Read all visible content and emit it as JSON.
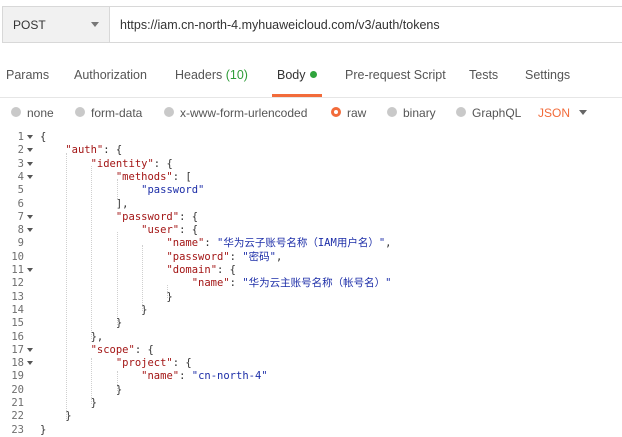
{
  "request": {
    "method": "POST",
    "url": "https://iam.cn-north-4.myhuaweicloud.com/v3/auth/tokens"
  },
  "tabs": [
    {
      "label": "Params"
    },
    {
      "label": "Authorization"
    },
    {
      "label": "Headers",
      "count": "(10)"
    },
    {
      "label": "Body"
    },
    {
      "label": "Pre-request Script"
    },
    {
      "label": "Tests"
    },
    {
      "label": "Settings"
    }
  ],
  "body_types": [
    {
      "label": "none",
      "selected": false
    },
    {
      "label": "form-data",
      "selected": false
    },
    {
      "label": "x-www-form-urlencoded",
      "selected": false
    },
    {
      "label": "raw",
      "selected": true
    },
    {
      "label": "binary",
      "selected": false
    },
    {
      "label": "GraphQL",
      "selected": false
    }
  ],
  "format": "JSON",
  "colors": {
    "accent": "#f26b3a",
    "active_dot": "#2fa43c",
    "key": "#a31515",
    "string": "#1d2ea8"
  },
  "code_lines": [
    {
      "n": "1",
      "text": "{"
    },
    {
      "n": "2",
      "text": "    \"auth\": {"
    },
    {
      "n": "3",
      "text": "        \"identity\": {"
    },
    {
      "n": "4",
      "text": "            \"methods\": ["
    },
    {
      "n": "5",
      "text": "                \"password\""
    },
    {
      "n": "6",
      "text": "            ],"
    },
    {
      "n": "7",
      "text": "            \"password\": {"
    },
    {
      "n": "8",
      "text": "                \"user\": {"
    },
    {
      "n": "9",
      "text": "                    \"name\": \"华为云子账号名称（IAM用户名）\","
    },
    {
      "n": "10",
      "text": "                    \"password\": \"密码\","
    },
    {
      "n": "11",
      "text": "                    \"domain\": {"
    },
    {
      "n": "12",
      "text": "                        \"name\": \"华为云主账号名称（帐号名）\""
    },
    {
      "n": "13",
      "text": "                    }"
    },
    {
      "n": "14",
      "text": "                }"
    },
    {
      "n": "15",
      "text": "            }"
    },
    {
      "n": "16",
      "text": "        },"
    },
    {
      "n": "17",
      "text": "        \"scope\": {"
    },
    {
      "n": "18",
      "text": "            \"project\": {"
    },
    {
      "n": "19",
      "text": "                \"name\": \"cn-north-4\""
    },
    {
      "n": "20",
      "text": "            }"
    },
    {
      "n": "21",
      "text": "        }"
    },
    {
      "n": "22",
      "text": "    }"
    },
    {
      "n": "23",
      "text": "}"
    }
  ]
}
